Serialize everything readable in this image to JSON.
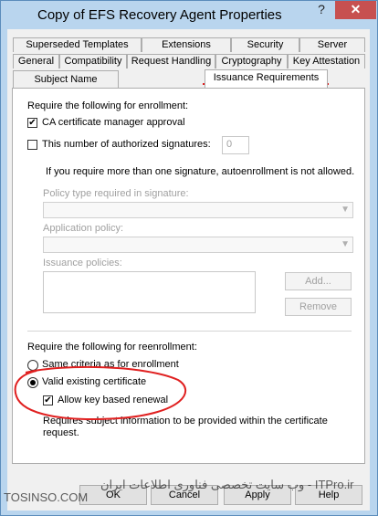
{
  "window": {
    "title": "Copy of EFS Recovery Agent Properties",
    "help_glyph": "?",
    "close_glyph": "✕"
  },
  "tabs": {
    "row1": [
      "Superseded Templates",
      "Extensions",
      "Security",
      "Server"
    ],
    "row2": [
      "General",
      "Compatibility",
      "Request Handling",
      "Cryptography",
      "Key Attestation"
    ],
    "row3": [
      "Subject Name",
      "Issuance Requirements"
    ],
    "active": "Issuance Requirements"
  },
  "enrollment": {
    "heading": "Require the following for enrollment:",
    "ca_manager_label": "CA certificate manager approval",
    "ca_manager_checked": true,
    "signatures_label": "This number of authorized signatures:",
    "signatures_checked": false,
    "signatures_value": "0",
    "autoenroll_note": "If you require more than one signature, autoenrollment is not allowed.",
    "policy_type_label": "Policy type required in signature:",
    "application_policy_label": "Application policy:",
    "issuance_policies_label": "Issuance policies:",
    "add_label": "Add...",
    "remove_label": "Remove"
  },
  "reenrollment": {
    "heading": "Require the following for reenrollment:",
    "same_criteria_label": "Same criteria as for enrollment",
    "valid_cert_label": "Valid existing certificate",
    "selected": "valid_existing_certificate",
    "allow_key_label": "Allow key based renewal",
    "allow_key_checked": true,
    "note_line1": "Requires subject information to be provided within the certificate",
    "note_line2": "request."
  },
  "buttons": {
    "ok": "OK",
    "cancel": "Cancel",
    "apply": "Apply",
    "help": "Help"
  },
  "watermarks": {
    "left": "TOSINSO.COM",
    "right": "وب سایت تخصصی فناوری اطلاعات ایران - ITPro.ir"
  },
  "colors": {
    "annotation_red": "#e02020",
    "close_button": "#c75050",
    "title_bar": "#b9d5ee"
  }
}
